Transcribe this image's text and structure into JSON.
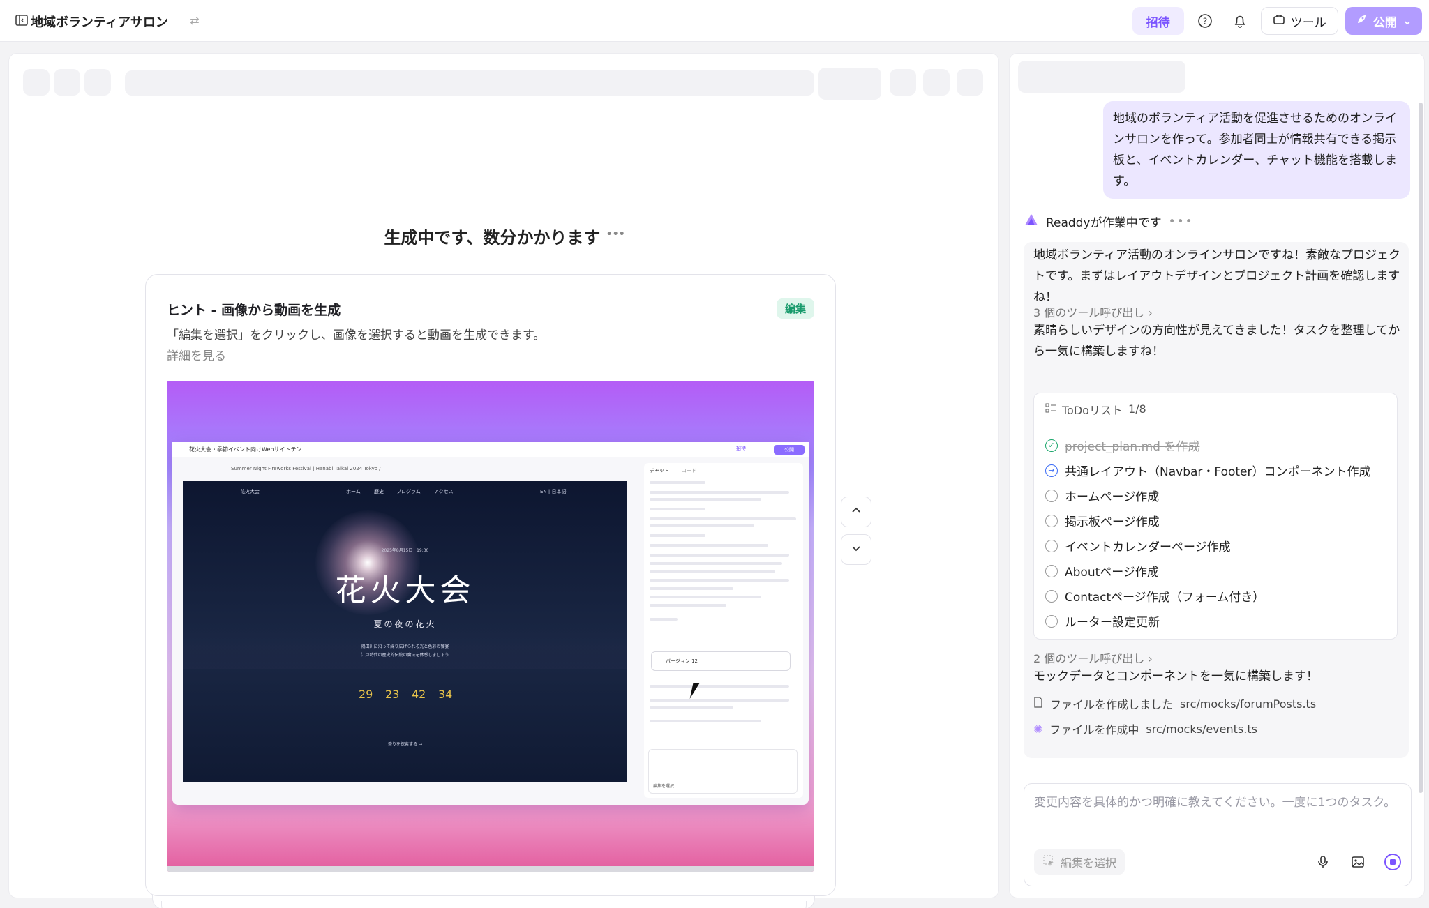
{
  "topbar": {
    "project_title": "地域ボランティアサロン",
    "invite_label": "招待",
    "tools_label": "ツール",
    "publish_label": "公開"
  },
  "preview": {
    "generating_text": "生成中です、数分かかります",
    "hint": {
      "title": "ヒント - 画像から動画を生成",
      "badge": "編集",
      "description": "「編集を選択」をクリックし、画像を選択すると動画を生成できます。",
      "link": "詳細を見る"
    },
    "mock": {
      "window_title": "花火大会・季節イベント向けWebサイトテン...",
      "invite": "招待",
      "publish": "公開",
      "url": "Summer Night Fireworks Festival | Hanabi Taikai 2024 Tokyo  /",
      "nav": [
        "花火大会",
        "ホーム",
        "歴史",
        "プログラム",
        "アクセス",
        "EN | 日本語"
      ],
      "date": "2025年8月15日 · 19:30",
      "title": "花火大会",
      "subtitle": "夏の夜の花火",
      "desc_line1": "隅田川に沿って繰り広げられる光と色彩の饗宴",
      "desc_line2": "江戸時代の歴史的伝統の魔法を体感しましょう",
      "countdown": [
        "29",
        "23",
        "42",
        "34"
      ],
      "cta": "祭りを探索する →",
      "chat_tabs": [
        "チャット",
        "コード"
      ],
      "version_label": "バージョン 12",
      "edit_select": "編集を選択"
    }
  },
  "chat": {
    "user_message": "地域のボランティア活動を促進させるためのオンラインサロンを作って。参加者同士が情報共有できる掲示板と、イベントカレンダー、チャット機能を搭載します。",
    "agent_status": "Readdyが作業中です",
    "msg1": "地域ボランティア活動のオンラインサロンですね！素敵なプロジェクトです。まずはレイアウトデザインとプロジェクト計画を確認しますね！",
    "tool_calls_1": "3 個のツール呼び出し",
    "msg2": "素晴らしいデザインの方向性が見えてきました！タスクを整理してから一気に構築しますね！",
    "todo": {
      "title": "ToDoリスト",
      "progress": "1/8",
      "items": [
        {
          "label": "project_plan.md を作成",
          "status": "done"
        },
        {
          "label": "共通レイアウト（Navbar・Footer）コンポーネント作成",
          "status": "active"
        },
        {
          "label": "ホームページ作成",
          "status": "pending"
        },
        {
          "label": "掲示板ページ作成",
          "status": "pending"
        },
        {
          "label": "イベントカレンダーページ作成",
          "status": "pending"
        },
        {
          "label": "Aboutページ作成",
          "status": "pending"
        },
        {
          "label": "Contactページ作成（フォーム付き）",
          "status": "pending"
        },
        {
          "label": "ルーター設定更新",
          "status": "pending"
        }
      ]
    },
    "tool_calls_2": "2 個のツール呼び出し",
    "msg3": "モックデータとコンポーネントを一気に構築します！",
    "file1_status": "ファイルを作成しました",
    "file1_path": "src/mocks/forumPosts.ts",
    "file2_status": "ファイルを作成中",
    "file2_path": "src/mocks/events.ts",
    "input_placeholder": "変更内容を具体的かつ明確に教えてください。一度に1つのタスク。",
    "edit_select": "編集を選択"
  },
  "colors": {
    "accent": "#7b54ff",
    "publish_bg": "#b29cff",
    "invite_bg": "#f0ecff",
    "badge_bg": "#dff6ec",
    "badge_fg": "#179a6b",
    "done": "#1aa66b",
    "active": "#3b6cf6"
  },
  "icons": {
    "sidebar_toggle": "sidebar-toggle-icon",
    "swap": "swap-icon",
    "help": "help-icon",
    "bell": "bell-icon",
    "tools": "toolbox-icon",
    "rocket": "rocket-icon",
    "chevron_up": "chevron-up-icon",
    "chevron_down": "chevron-down-icon",
    "mic": "microphone-icon",
    "image": "image-icon",
    "stop": "stop-icon"
  }
}
